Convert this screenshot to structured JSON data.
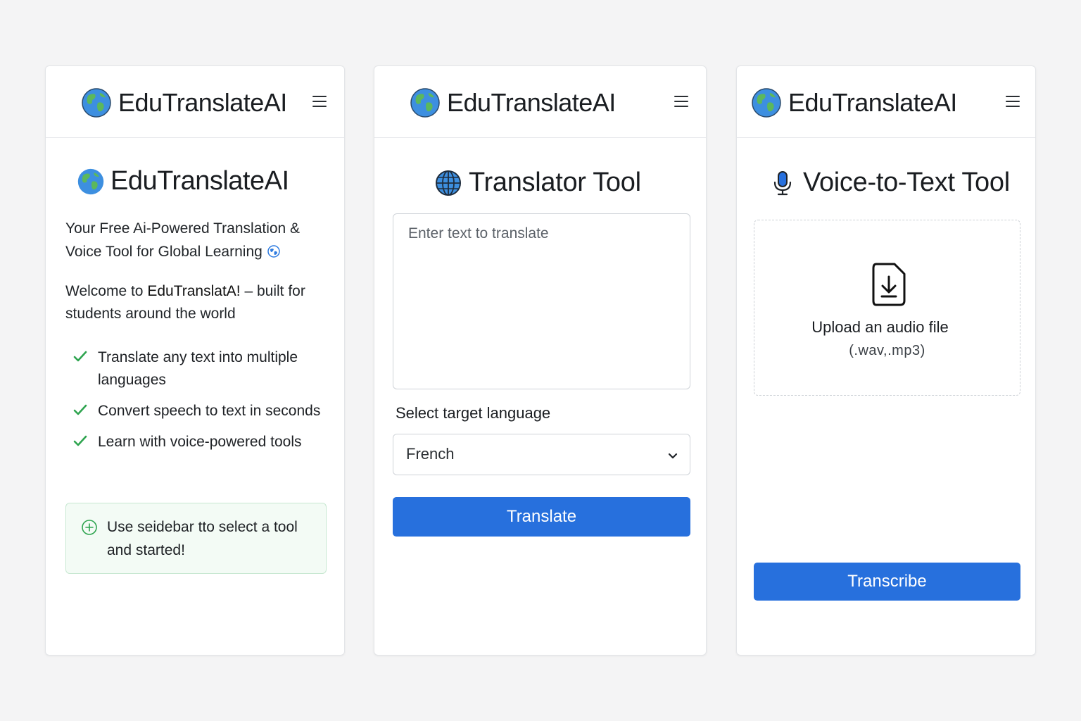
{
  "app": {
    "brand": "EduTranslateAI",
    "colors": {
      "primary": "#2770dd",
      "success": "#2ea44f",
      "notice_bg": "#f3fbf5",
      "background": "#f4f4f5"
    }
  },
  "home": {
    "title": "EduTranslateAI",
    "tagline": "Your Free Ai-Powered Translation & Voice Tool for Global Learning",
    "welcome_prefix": "Welcome to ",
    "welcome_name": "EduTranslatA!",
    "welcome_suffix": " – built for students around the world",
    "features": [
      "Translate any text into multiple languages",
      "Convert speech to text in seconds",
      "Learn with voice-powered tools"
    ],
    "notice": "Use seidebar tto select a tool and started!"
  },
  "translator": {
    "title": "Translator Tool",
    "input_placeholder": "Enter text to translate",
    "input_value": "",
    "select_label": "Select target language",
    "selected_language": "French",
    "button_label": "Translate"
  },
  "voice": {
    "title": "Voice-to-Text Tool",
    "upload_title": "Upload an audio file",
    "upload_formats": "(.wav,.mp3)",
    "button_label": "Transcribe"
  },
  "icons": [
    "globe-icon",
    "menu-icon",
    "check-icon",
    "plus-circle-icon",
    "globe-grid-icon",
    "chevron-down-icon",
    "microphone-icon",
    "file-download-icon"
  ]
}
